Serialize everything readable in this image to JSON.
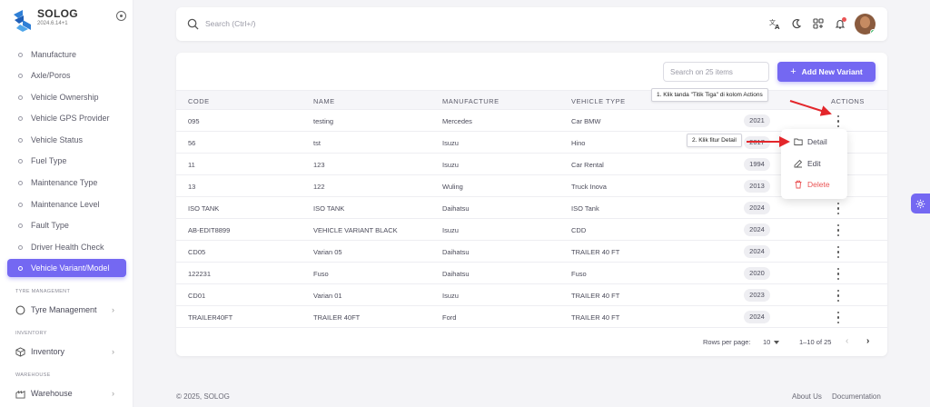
{
  "brand": {
    "name": "SOLOG",
    "version": "2024.6.14+1"
  },
  "sidebar": {
    "items": [
      {
        "label": "Manufacture"
      },
      {
        "label": "Axle/Poros"
      },
      {
        "label": "Vehicle Ownership"
      },
      {
        "label": "Vehicle GPS Provider"
      },
      {
        "label": "Vehicle Status"
      },
      {
        "label": "Fuel Type"
      },
      {
        "label": "Maintenance Type"
      },
      {
        "label": "Maintenance Level"
      },
      {
        "label": "Fault Type"
      },
      {
        "label": "Driver Health Check"
      },
      {
        "label": "Vehicle Variant/Model",
        "active": true
      }
    ],
    "sections": [
      {
        "title": "TYRE MANAGEMENT",
        "item": "Tyre Management",
        "icon": "circle-icon"
      },
      {
        "title": "INVENTORY",
        "item": "Inventory",
        "icon": "box-icon"
      },
      {
        "title": "WAREHOUSE",
        "item": "Warehouse",
        "icon": "warehouse-icon"
      }
    ]
  },
  "topbar": {
    "search_placeholder": "Search (Ctrl+/)",
    "icons": [
      "translate-icon",
      "theme-icon",
      "shortcuts-icon",
      "bell-icon",
      "avatar"
    ]
  },
  "table": {
    "search_placeholder": "Search on 25 items",
    "add_button_label": "Add New Variant",
    "columns": [
      "CODE",
      "NAME",
      "MANUFACTURE",
      "VEHICLE TYPE",
      "ACTIONS"
    ],
    "rows": [
      {
        "code": "095",
        "name": "testing",
        "manufacture": "Mercedes",
        "type": "Car BMW",
        "year": "2021"
      },
      {
        "code": "56",
        "name": "tst",
        "manufacture": "Isuzu",
        "type": "Hino",
        "year": "2017"
      },
      {
        "code": "11",
        "name": "123",
        "manufacture": "Isuzu",
        "type": "Car Rental",
        "year": "1994"
      },
      {
        "code": "13",
        "name": "122",
        "manufacture": "Wuling",
        "type": "Truck Inova",
        "year": "2013"
      },
      {
        "code": "ISO TANK",
        "name": "ISO TANK",
        "manufacture": "Daihatsu",
        "type": "ISO Tank",
        "year": "2024"
      },
      {
        "code": "AB-EDIT8899",
        "name": "VEHICLE VARIANT BLACK",
        "manufacture": "Isuzu",
        "type": "CDD",
        "year": "2024"
      },
      {
        "code": "CD05",
        "name": "Varian 05",
        "manufacture": "Daihatsu",
        "type": "TRAILER 40 FT",
        "year": "2024"
      },
      {
        "code": "122231",
        "name": "Fuso",
        "manufacture": "Daihatsu",
        "type": "Fuso",
        "year": "2020"
      },
      {
        "code": "CD01",
        "name": "Varian 01",
        "manufacture": "Isuzu",
        "type": "TRAILER 40 FT",
        "year": "2023"
      },
      {
        "code": "TRAILER40FT",
        "name": "TRAILER 40FT",
        "manufacture": "Ford",
        "type": "TRAILER 40 FT",
        "year": "2024"
      }
    ],
    "pagination": {
      "rows_per_page_label": "Rows per page:",
      "rows_per_page": "10",
      "range": "1–10 of 25"
    }
  },
  "dropdown": {
    "items": [
      "Detail",
      "Edit",
      "Delete"
    ]
  },
  "callouts": {
    "step1": "1. Klik tanda \"Titik Tiga\" di kolom Actions",
    "step2": "2. Klik fitur Detail"
  },
  "footer": {
    "copyright": "© 2025, SOLOG",
    "links": [
      "About Us",
      "Documentation"
    ]
  },
  "colors": {
    "primary": "#7468f2",
    "danger": "#ea5455",
    "annotation_arrow": "#e3262b"
  }
}
